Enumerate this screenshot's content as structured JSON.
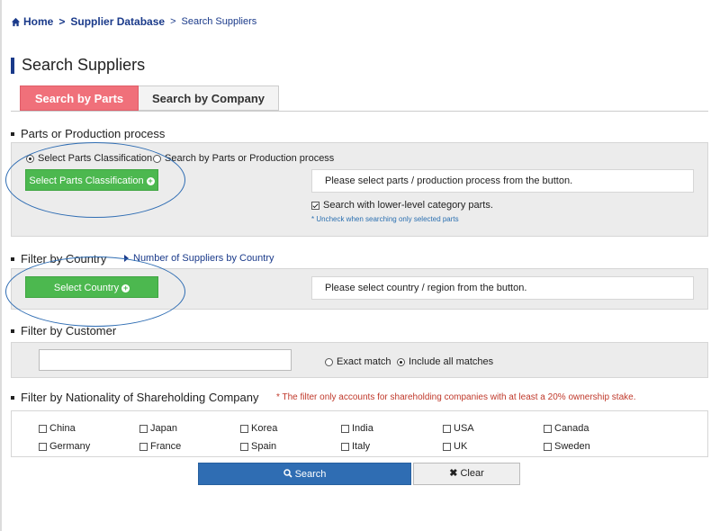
{
  "breadcrumb": {
    "home": "Home",
    "db": "Supplier Database",
    "current": "Search Suppliers",
    "sep": ">"
  },
  "page_title": "Search Suppliers",
  "tabs": [
    {
      "label": "Search by Parts"
    },
    {
      "label": "Search by Company"
    }
  ],
  "parts": {
    "heading": "Parts or Production process",
    "radio_classification": "Select Parts Classification",
    "radio_process": "Search by Parts or Production process",
    "button": "Select Parts Classification",
    "info": "Please select parts / production process from the button.",
    "lower_level": "Search with lower-level category parts.",
    "note": "* Uncheck when searching only selected parts"
  },
  "country": {
    "heading": "Filter by Country",
    "link": "Number of Suppliers by Country",
    "button": "Select Country",
    "info": "Please select country / region from the button."
  },
  "customer": {
    "heading": "Filter by Customer",
    "input_value": "",
    "exact": "Exact match",
    "include": "Include all matches"
  },
  "nationality": {
    "heading": "Filter by Nationality of Shareholding Company",
    "warning": "* The filter only accounts for shareholding companies with at least a 20% ownership stake.",
    "countries": [
      "China",
      "Japan",
      "Korea",
      "India",
      "USA",
      "Canada",
      "Germany",
      "France",
      "Spain",
      "Italy",
      "UK",
      "Sweden"
    ]
  },
  "actions": {
    "search": "Search",
    "clear": "Clear"
  },
  "colors": {
    "accent_blue": "#2f6db3",
    "tab_active": "#f0707a",
    "green_btn": "#4cb84f",
    "warning": "#c0392b",
    "nav": "#1a3a8a"
  }
}
